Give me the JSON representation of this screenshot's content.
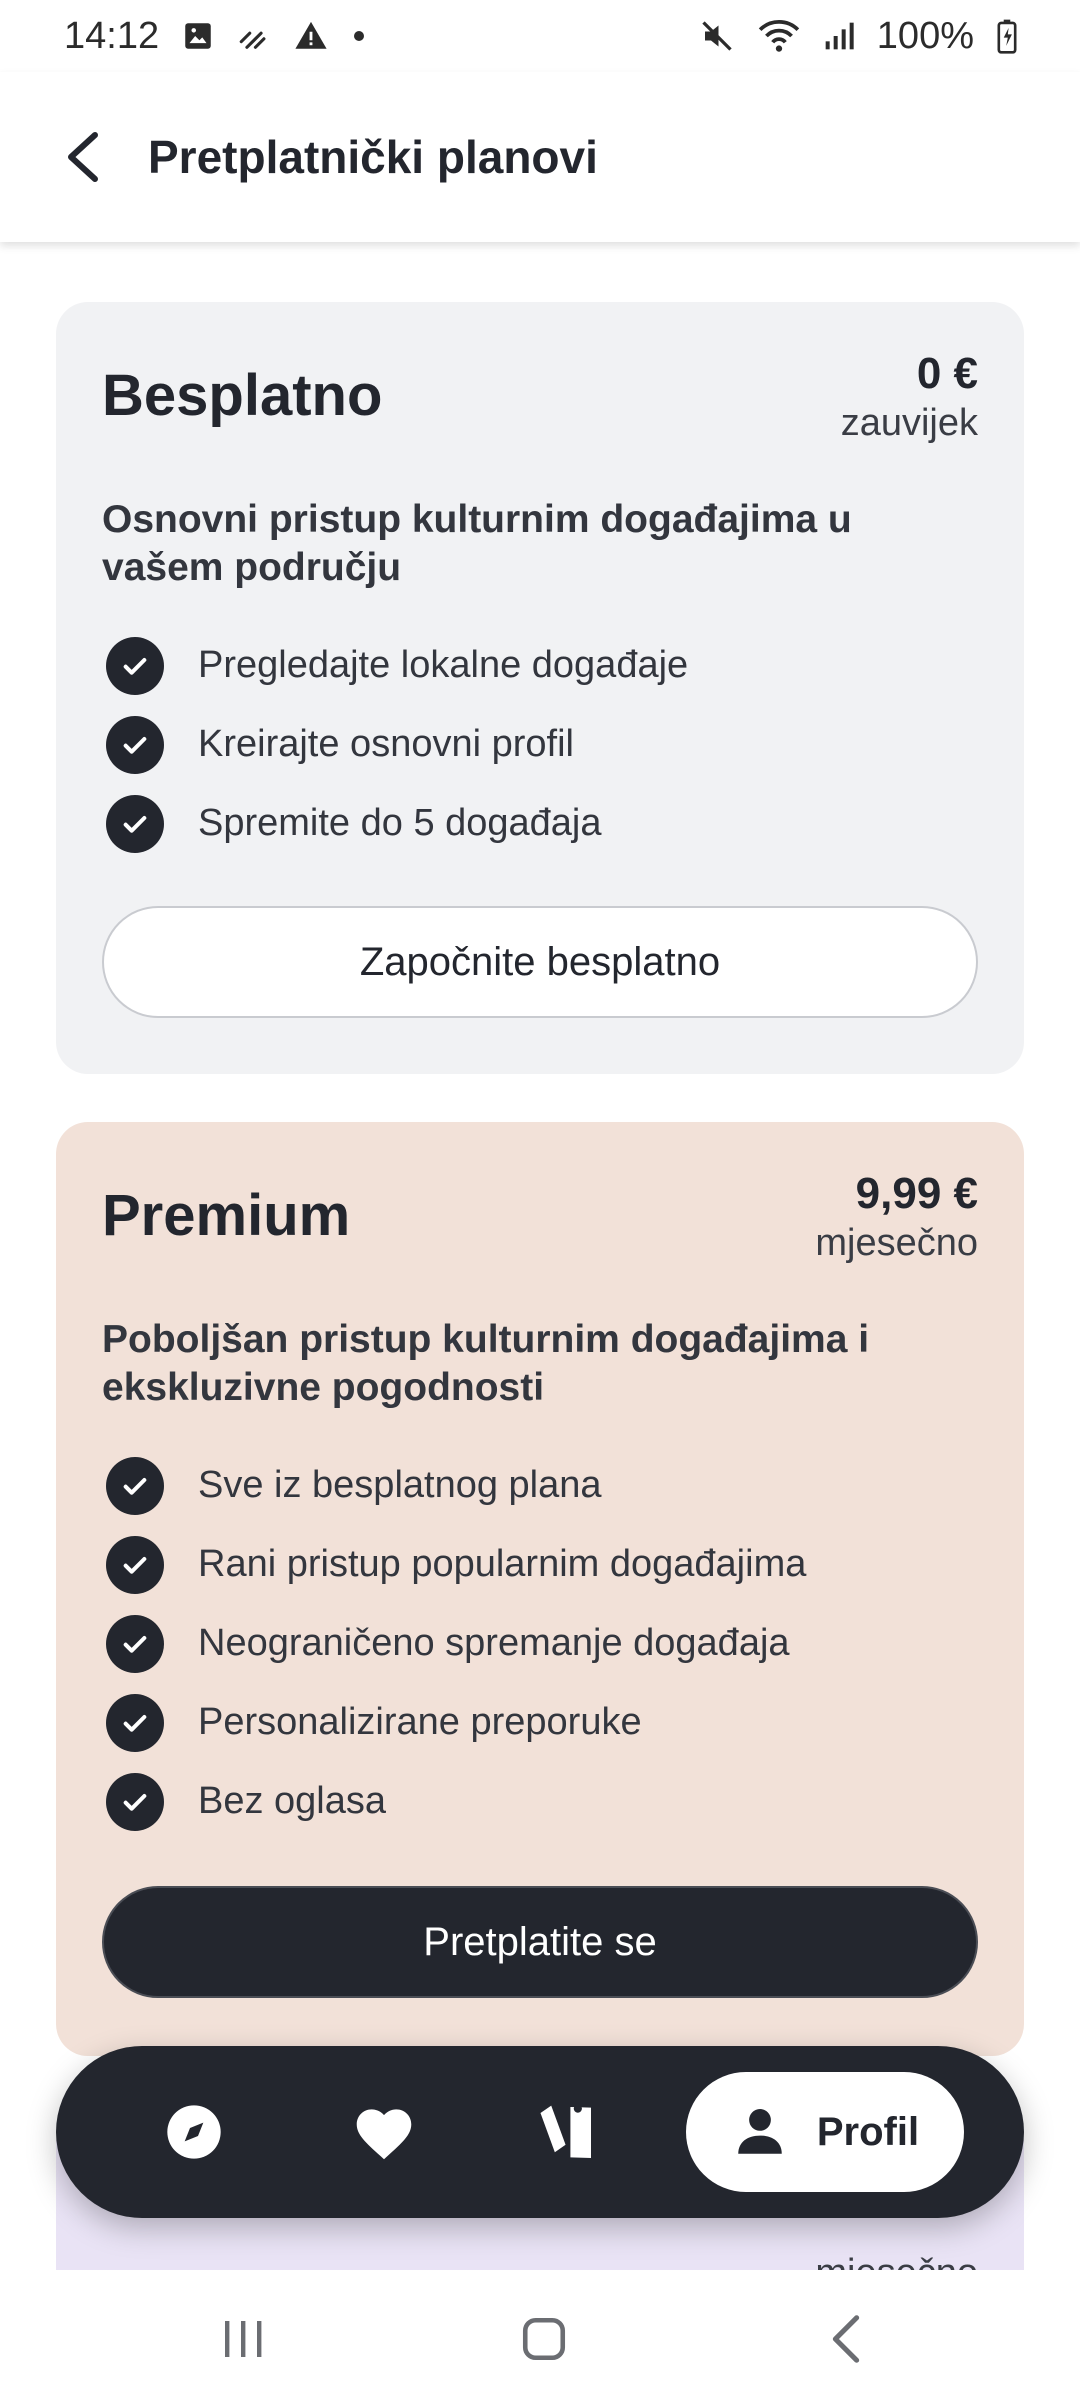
{
  "status_bar": {
    "time": "14:12",
    "battery": "100%",
    "icons": [
      "image-icon",
      "missed-call-icon",
      "warning-icon",
      "dot-icon",
      "mute-icon",
      "wifi-icon",
      "signal-icon",
      "battery-icon"
    ]
  },
  "app_bar": {
    "title": "Pretplatnički planovi",
    "back_icon": "back-arrow-icon"
  },
  "plans": [
    {
      "name": "Besplatno",
      "price": "0 €",
      "period": "zauvijek",
      "description": "Osnovni pristup kulturnim događajima u vašem području",
      "features": [
        "Pregledajte lokalne događaje",
        "Kreirajte osnovni profil",
        "Spremite do 5 događaja"
      ],
      "button": "Započnite besplatno"
    },
    {
      "name": "Premium",
      "price": "9,99 €",
      "period": "mjesečno",
      "description": "Poboljšan pristup kulturnim događajima i ekskluzivne pogodnosti",
      "features": [
        "Sve iz besplatnog plana",
        "Rani pristup popularnim događajima",
        "Neograničeno spremanje događaja",
        "Personalizirane preporuke",
        "Bez oglasa"
      ],
      "button": "Pretplatite se"
    },
    {
      "period": "mjesečno"
    }
  ],
  "bottom_nav": {
    "items": [
      {
        "icon": "compass-icon"
      },
      {
        "icon": "heart-icon"
      },
      {
        "icon": "tickets-icon"
      },
      {
        "icon": "profile-icon",
        "label": "Profil",
        "active": true
      }
    ]
  },
  "system_nav": {
    "icons": [
      "recent-apps-icon",
      "home-icon",
      "back-icon"
    ]
  },
  "colors": {
    "dark": "#23262e",
    "free_card": "#f1f2f4",
    "premium_card": "#f2e1d8",
    "third_card": "#e9e3f5"
  }
}
